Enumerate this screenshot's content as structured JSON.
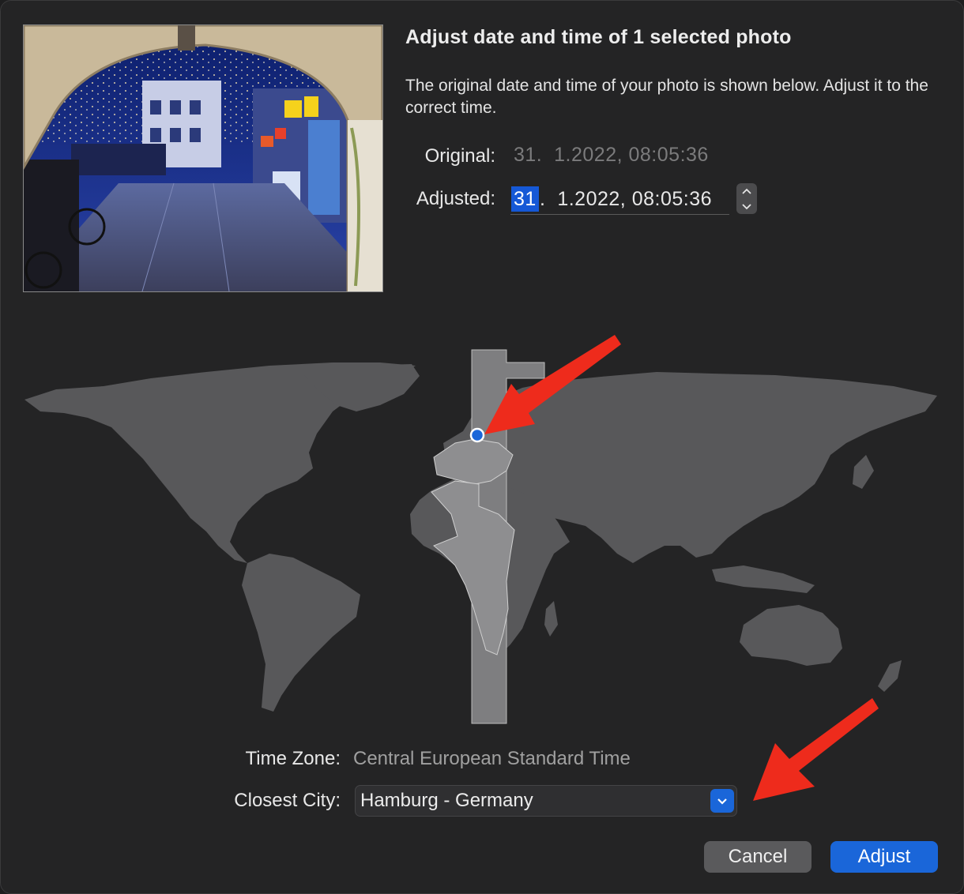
{
  "dialog": {
    "title": "Adjust date and time of 1 selected photo",
    "description": "The original date and time of your photo is shown below. Adjust it to the correct time."
  },
  "dates": {
    "original_label": "Original:",
    "original_value": "31.  1.2022, 08:05:36",
    "adjusted_label": "Adjusted:",
    "adjusted_day": "31",
    "adjusted_rest": ".  1.2022, 08:05:36"
  },
  "timezone": {
    "label": "Time Zone:",
    "value": "Central European Standard Time"
  },
  "city": {
    "label": "Closest City:",
    "value": "Hamburg - Germany"
  },
  "buttons": {
    "cancel": "Cancel",
    "adjust": "Adjust"
  },
  "colors": {
    "accent": "#1a66d9",
    "selection": "#1558d6",
    "annotation_arrow": "#ee2b1c"
  },
  "icons": {
    "stepper_up": "chevron-up-icon",
    "stepper_down": "chevron-down-icon",
    "popup": "chevron-down-icon",
    "location_pin": "location-dot-icon"
  }
}
